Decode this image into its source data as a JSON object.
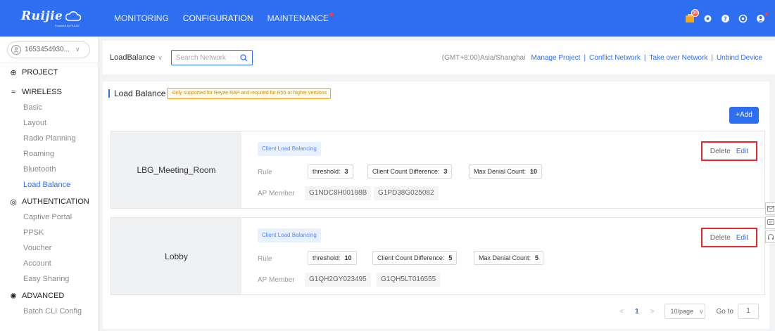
{
  "brand": {
    "logo_text": "Ruijie",
    "logo_sub": "Powered by RUIJIE"
  },
  "topnav": [
    {
      "label": "MONITORING",
      "active": false
    },
    {
      "label": "CONFIGURATION",
      "active": true
    },
    {
      "label": "MAINTENANCE",
      "active": false,
      "alert": true
    }
  ],
  "top_icons": [
    "notification-icon",
    "settings-icon",
    "help-icon",
    "language-icon",
    "user-icon"
  ],
  "notification_badge": "99",
  "sidebar": {
    "account": "1653454930...",
    "project": "PROJECT",
    "wireless": "WIRELESS",
    "wireless_items": [
      "Basic",
      "Layout",
      "Radio Planning",
      "Roaming",
      "Bluetooth",
      "Load Balance"
    ],
    "authentication": "AUTHENTICATION",
    "auth_items": [
      "Captive Portal",
      "PPSK",
      "Voucher",
      "Account",
      "Easy Sharing"
    ],
    "advanced": "ADVANCED",
    "advanced_items": [
      "Batch CLI Config"
    ]
  },
  "toolbar": {
    "network": "LoadBalance",
    "search_placeholder": "Search Network",
    "timezone": "(GMT+8:00)Asia/Shanghai",
    "links": [
      "Manage Project",
      "Conflict Network",
      "Take over Network",
      "Unbind Device"
    ]
  },
  "panel": {
    "title": "Load Balance",
    "tip": "Only supported for Reyee RAP and required for R55 or higher versions",
    "add_label": "+Add"
  },
  "cards": [
    {
      "name": "LBG_Meeting_Room",
      "type": "Client Load Balancing",
      "rule_label": "Rule",
      "threshold_label": "threshold:",
      "threshold": "3",
      "diff_label": "Client Count Difference:",
      "diff": "3",
      "denial_label": "Max Denial Count:",
      "denial": "10",
      "ap_label": "AP Member",
      "aps": [
        "G1NDC8H00198B",
        "G1PD38G025082"
      ],
      "delete": "Delete",
      "edit": "Edit"
    },
    {
      "name": "Lobby",
      "type": "Client Load Balancing",
      "rule_label": "Rule",
      "threshold_label": "threshold:",
      "threshold": "10",
      "diff_label": "Client Count Difference:",
      "diff": "5",
      "denial_label": "Max Denial Count:",
      "denial": "5",
      "ap_label": "AP Member",
      "aps": [
        "G1QH2GY023495",
        "G1QH5LT016555"
      ],
      "delete": "Delete",
      "edit": "Edit"
    }
  ],
  "pager": {
    "prev": "<",
    "page": "1",
    "next": ">",
    "page_size": "10/page",
    "goto_label": "Go to",
    "goto_value": "1"
  }
}
